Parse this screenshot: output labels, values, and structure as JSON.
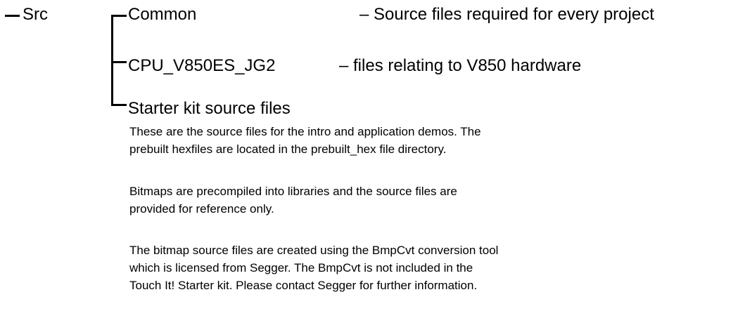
{
  "root": {
    "label": "Src"
  },
  "children": [
    {
      "name": "Common",
      "description": "– Source files required for every project"
    },
    {
      "name": "CPU_V850ES_JG2",
      "description": "– files relating to V850 hardware"
    },
    {
      "name": "Starter kit source files",
      "description": ""
    }
  ],
  "notes": [
    "These are the source files for the intro and application demos. The",
    "prebuilt  hexfiles are located in the prebuilt_hex file directory.",
    "Bitmaps are precompiled into libraries and the source files are",
    "provided for reference only.",
    "The bitmap source files are created using the BmpCvt conversion tool",
    "which is licensed from Segger. The BmpCvt is not included in the",
    "Touch It! Starter kit. Please contact Segger for further information."
  ]
}
